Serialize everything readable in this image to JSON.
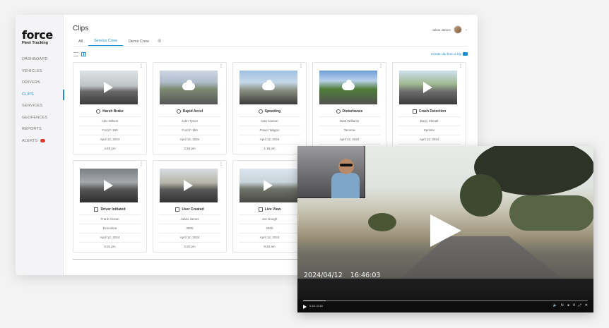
{
  "sidebar": {
    "logo_main": "force",
    "logo_sub": "Fleet Tracking",
    "items": [
      {
        "label": "DASHBOARD"
      },
      {
        "label": "VEHICLES"
      },
      {
        "label": "DRIVERS"
      },
      {
        "label": "CLIPS"
      },
      {
        "label": "SERVICES"
      },
      {
        "label": "GEOFENCES"
      },
      {
        "label": "REPORTS"
      },
      {
        "label": "ALERTS"
      }
    ]
  },
  "header": {
    "title": "Clips",
    "user_name": "Julian James"
  },
  "tabs": [
    "All",
    "Service Crew",
    "Demo Crew"
  ],
  "create_clip_label": "Create clip from a trip",
  "cards": [
    {
      "event": "Harsh Brake",
      "driver": "Alex Wilson",
      "vehicle": "Ford F-150",
      "date": "April 12, 2024",
      "time": "4:46 pm"
    },
    {
      "event": "Rapid Accel",
      "driver": "John Tyson",
      "vehicle": "Ford F-150",
      "date": "April 12, 2024",
      "time": "3:34 pm"
    },
    {
      "event": "Speeding",
      "driver": "Ivan Carson",
      "vehicle": "Power Wagon",
      "date": "April 12, 2024",
      "time": "1:18 pm"
    },
    {
      "event": "Disturbance",
      "driver": "Nate Williams",
      "vehicle": "Tacoma",
      "date": "April 12, 2024",
      "time": ""
    },
    {
      "event": "Crash Detection",
      "driver": "Barry Shinall",
      "vehicle": "Sprinter",
      "date": "April 12, 2024",
      "time": ""
    },
    {
      "event": "Driver Initiated",
      "driver": "Frank Ocean",
      "vehicle": "Econoline",
      "date": "April 12, 2024",
      "time": "5:31 pm"
    },
    {
      "event": "User Created",
      "driver": "Julian James",
      "vehicle": "2500",
      "date": "April 12, 2024",
      "time": "2:20 pm"
    },
    {
      "event": "Live View",
      "driver": "Joe Dough",
      "vehicle": "2500",
      "date": "April 12, 2024",
      "time": "9:40 am"
    }
  ],
  "player": {
    "timestamp_date": "2024/04/12",
    "timestamp_time": "16:46:03",
    "time_readout": "0:18 / 0:15",
    "progress_fraction": 0.08
  }
}
